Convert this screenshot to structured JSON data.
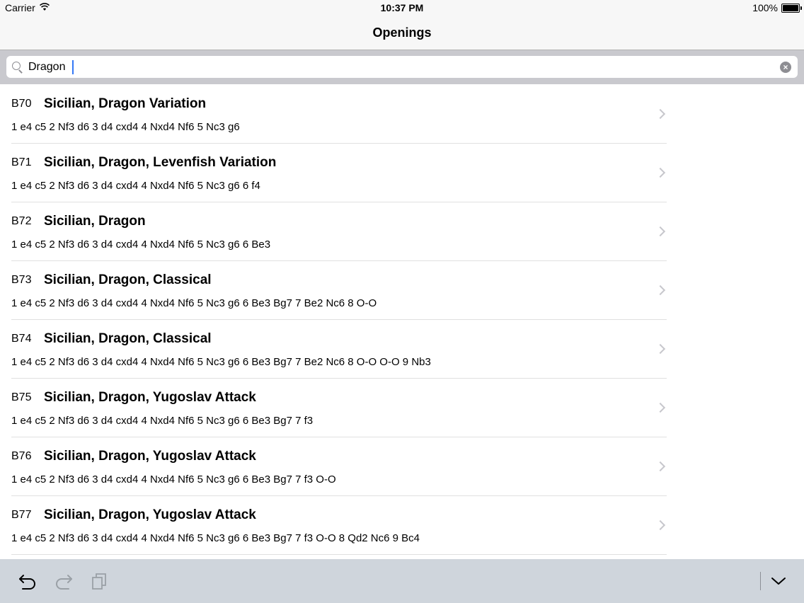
{
  "status_bar": {
    "carrier": "Carrier",
    "time": "10:37 PM",
    "battery": "100%",
    "icons": [
      "wifi-icon",
      "battery-icon"
    ]
  },
  "nav": {
    "title": "Openings"
  },
  "search": {
    "value": "Dragon",
    "icons": [
      "search-icon",
      "clear-icon"
    ]
  },
  "openings": [
    {
      "code": "B70",
      "name": "Sicilian, Dragon Variation",
      "moves": "1 e4 c5 2 Nf3 d6 3 d4 cxd4 4 Nxd4 Nf6 5 Nc3 g6"
    },
    {
      "code": "B71",
      "name": "Sicilian, Dragon, Levenfish Variation",
      "moves": "1 e4 c5 2 Nf3 d6 3 d4 cxd4 4 Nxd4 Nf6 5 Nc3 g6 6 f4"
    },
    {
      "code": "B72",
      "name": "Sicilian, Dragon",
      "moves": "1 e4 c5 2 Nf3 d6 3 d4 cxd4 4 Nxd4 Nf6 5 Nc3 g6 6 Be3"
    },
    {
      "code": "B73",
      "name": "Sicilian, Dragon, Classical",
      "moves": "1 e4 c5 2 Nf3 d6 3 d4 cxd4 4 Nxd4 Nf6 5 Nc3 g6 6 Be3 Bg7 7 Be2 Nc6 8 O-O"
    },
    {
      "code": "B74",
      "name": "Sicilian, Dragon, Classical",
      "moves": "1 e4 c5 2 Nf3 d6 3 d4 cxd4 4 Nxd4 Nf6 5 Nc3 g6 6 Be3 Bg7 7 Be2 Nc6 8 O-O O-O 9 Nb3"
    },
    {
      "code": "B75",
      "name": "Sicilian, Dragon, Yugoslav Attack",
      "moves": "1 e4 c5 2 Nf3 d6 3 d4 cxd4 4 Nxd4 Nf6 5 Nc3 g6 6 Be3 Bg7 7 f3"
    },
    {
      "code": "B76",
      "name": "Sicilian, Dragon, Yugoslav Attack",
      "moves": "1 e4 c5 2 Nf3 d6 3 d4 cxd4 4 Nxd4 Nf6 5 Nc3 g6 6 Be3 Bg7 7 f3 O-O"
    },
    {
      "code": "B77",
      "name": "Sicilian, Dragon, Yugoslav Attack",
      "moves": "1 e4 c5 2 Nf3 d6 3 d4 cxd4 4 Nxd4 Nf6 5 Nc3 g6 6 Be3 Bg7 7 f3 O-O 8 Qd2 Nc6 9 Bc4"
    }
  ],
  "toolbar": {
    "icons": [
      "undo-icon",
      "redo-icon",
      "copy-icon",
      "chevron-down-icon"
    ]
  }
}
